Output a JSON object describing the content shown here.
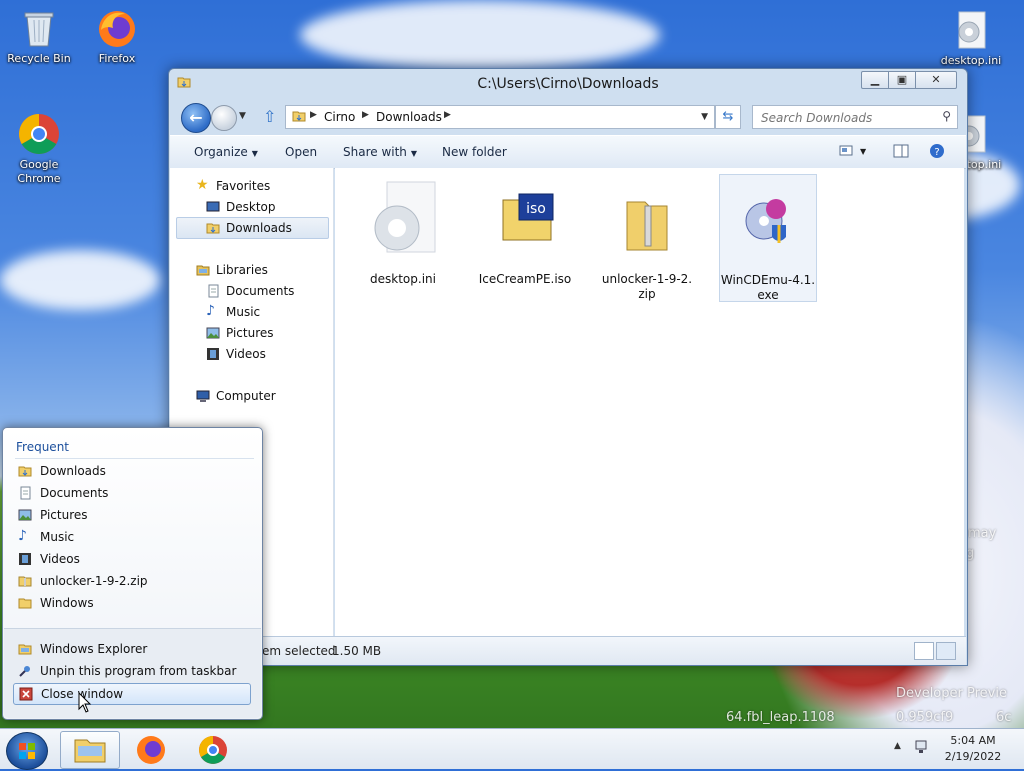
{
  "desktop": {
    "icons": [
      {
        "label": "Recycle Bin"
      },
      {
        "label": "Firefox"
      },
      {
        "label": "Google Chrome"
      },
      {
        "label": "desktop.ini"
      },
      {
        "label": "desktop.ini"
      }
    ],
    "watermark_1": "Developer Previe",
    "watermark_2": "64.fbl_leap.1108",
    "watermark_3": "0.959cf9",
    "watermark_4": "6c"
  },
  "explorer": {
    "title": "C:\\Users\\Cirno\\Downloads",
    "address": {
      "crumb_1": "Cirno",
      "crumb_2": "Downloads"
    },
    "search": {
      "placeholder": "Search Downloads"
    },
    "toolbar": {
      "organize": "Organize",
      "open": "Open",
      "share_with": "Share with",
      "new_folder": "New folder"
    },
    "navpane": {
      "favorites": "Favorites",
      "desktop": "Desktop",
      "downloads": "Downloads",
      "libraries": "Libraries",
      "documents": "Documents",
      "music": "Music",
      "pictures": "Pictures",
      "videos": "Videos",
      "computer": "Computer"
    },
    "files": [
      {
        "name": "desktop.ini"
      },
      {
        "name": "IceCreamPE.iso"
      },
      {
        "name": "unlocker-1-9-2.zip"
      },
      {
        "name": "WinCDEmu-4.1.exe"
      }
    ],
    "status": {
      "selected": "em selected",
      "size": "1.50 MB"
    }
  },
  "jumplist": {
    "header": "Frequent",
    "frequent": [
      {
        "label": "Downloads"
      },
      {
        "label": "Documents"
      },
      {
        "label": "Pictures"
      },
      {
        "label": "Music"
      },
      {
        "label": "Videos"
      },
      {
        "label": "unlocker-1-9-2.zip"
      },
      {
        "label": "Windows"
      }
    ],
    "tasks": [
      {
        "label": "Windows Explorer"
      },
      {
        "label": "Unpin this program from taskbar"
      },
      {
        "label": "Close window"
      }
    ]
  },
  "taskbar": {
    "time": "5:04 AM",
    "date": "2/19/2022"
  }
}
